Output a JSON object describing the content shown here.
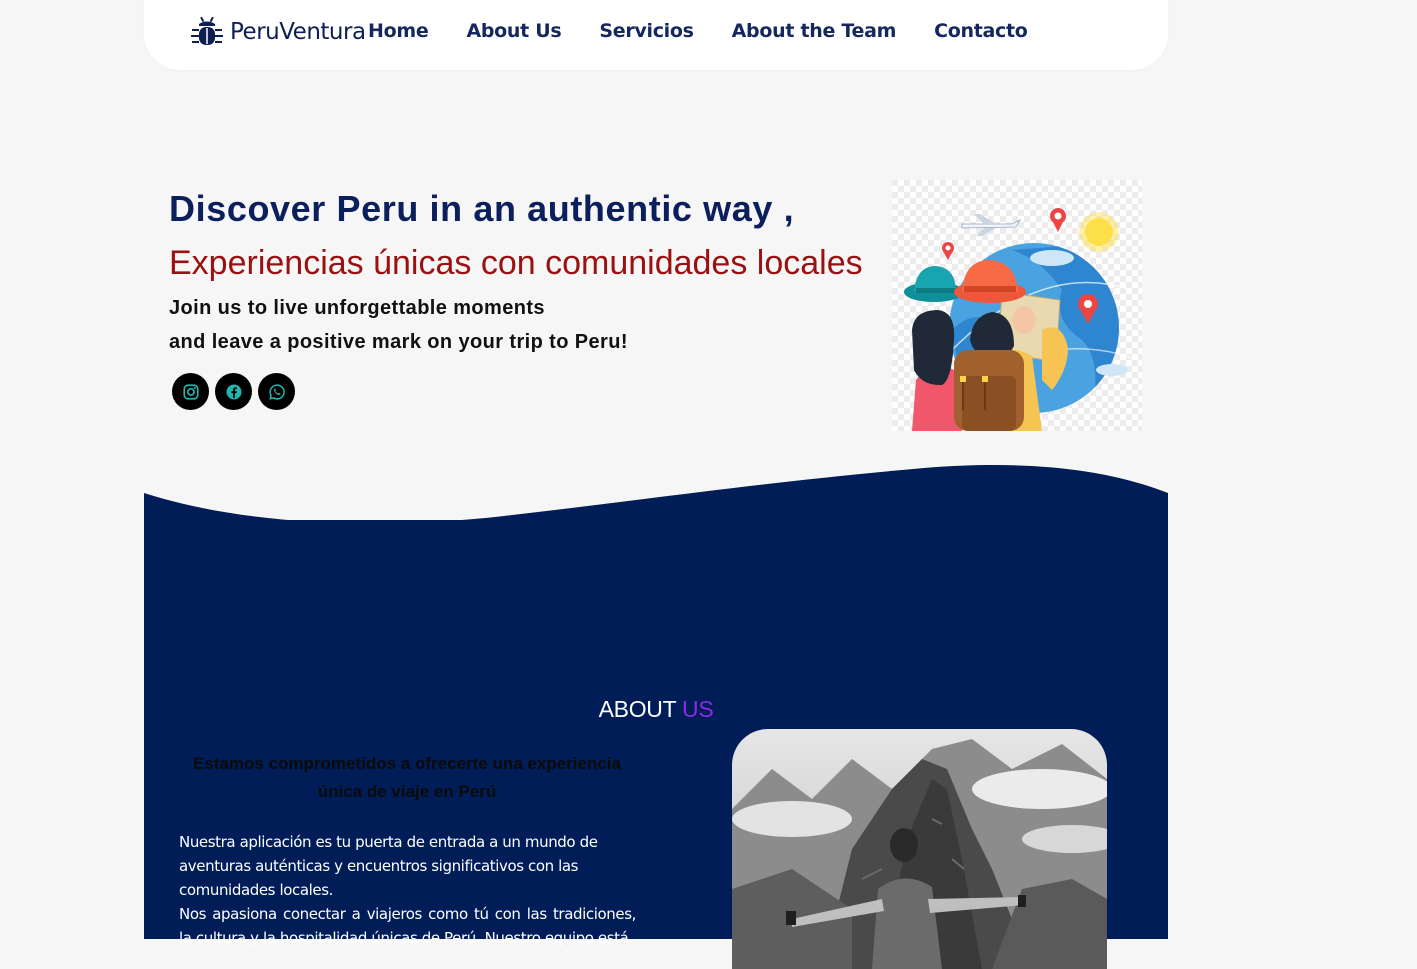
{
  "nav": {
    "brand": "PeruVentura",
    "items": [
      "Home",
      "About Us",
      "Servicios",
      "About the Team",
      "Contacto"
    ]
  },
  "hero": {
    "title": "Discover Peru in an authentic way ,",
    "subtitle": "Experiencias únicas con comunidades locales",
    "line1": "Join us to live unforgettable moments",
    "line2": "and leave a positive mark on your trip to Peru!",
    "socials": [
      "instagram-icon",
      "facebook-icon",
      "whatsapp-icon"
    ]
  },
  "about": {
    "heading_main": "ABOUT",
    "heading_accent": "US",
    "lead": "Estamos comprometidos a ofrecerte una experiencia única de viaje en Perú",
    "p1": "Nuestra aplicación es tu puerta de entrada a un mundo de aventuras auténticas y encuentros significativos con las comunidades locales.",
    "p2": "Nos apasiona conectar a viajeros como tú con las tradiciones, la cultura y la hospitalidad únicas de Perú. Nuestro equipo está"
  },
  "colors": {
    "page_bg": "#f6f6f6",
    "navy": "#001d57",
    "title": "#0b1f5c",
    "subtitle_red": "#9b1010",
    "accent_purple": "#8a2be2",
    "social_icon": "#1fb5b0"
  }
}
